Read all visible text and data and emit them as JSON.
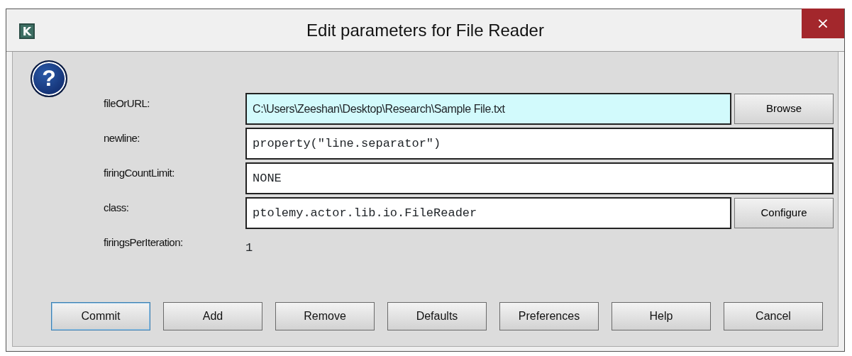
{
  "window": {
    "title": "Edit parameters for File Reader",
    "app_icon": "K",
    "close": "×",
    "help_icon": "?"
  },
  "parameters": [
    {
      "label": "fileOrURL:",
      "kind": "file",
      "value": "C:\\Users\\Zeeshan\\Desktop\\Research\\Sample File.txt",
      "button": "Browse"
    },
    {
      "label": "newline:",
      "kind": "expression",
      "value": "property(\"line.separator\")"
    },
    {
      "label": "firingCountLimit:",
      "kind": "expression",
      "value": "NONE"
    },
    {
      "label": "class:",
      "kind": "expression",
      "value": "ptolemy.actor.lib.io.FileReader",
      "button": "Configure"
    },
    {
      "label": "firingsPerIteration:",
      "kind": "fixed",
      "value": "1"
    }
  ],
  "buttons": [
    {
      "label": "Commit",
      "default": true
    },
    {
      "label": "Add",
      "default": false
    },
    {
      "label": "Remove",
      "default": false
    },
    {
      "label": "Defaults",
      "default": false
    },
    {
      "label": "Preferences",
      "default": false
    },
    {
      "label": "Help",
      "default": false
    },
    {
      "label": "Cancel",
      "default": false
    }
  ]
}
